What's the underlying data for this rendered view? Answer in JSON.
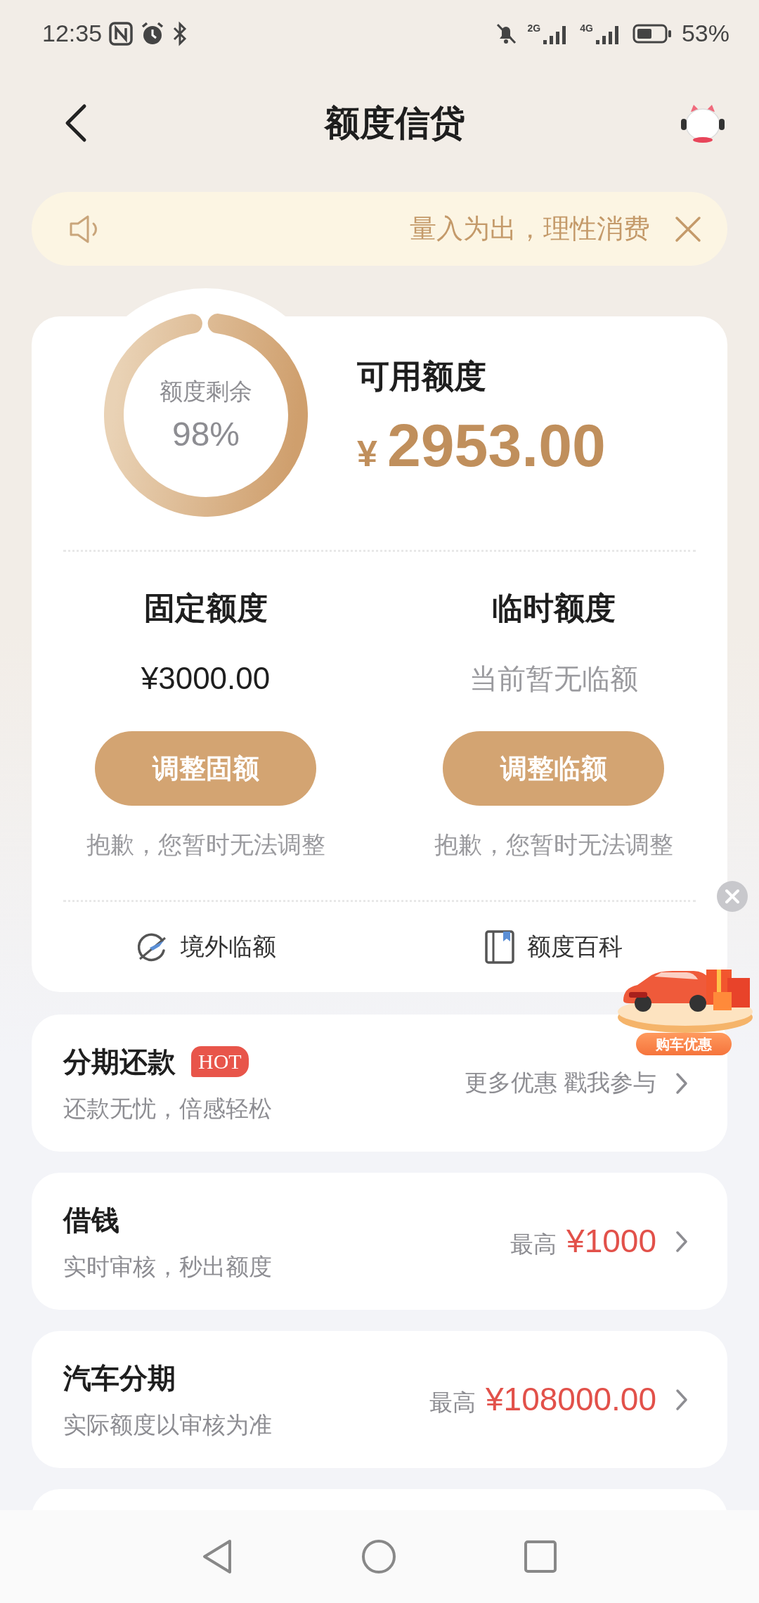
{
  "status_bar": {
    "time": "12:35",
    "network": [
      "2G",
      "4G"
    ],
    "battery": "53%"
  },
  "header": {
    "title": "额度信贷"
  },
  "notice": {
    "text": "量入为出，理性消费"
  },
  "credit": {
    "ring_label": "额度剩余",
    "ring_value": "98%",
    "level": 0.98,
    "available_label": "可用额度",
    "currency": "¥",
    "available_amount": "2953.00",
    "columns": [
      {
        "title": "固定额度",
        "value": "¥3000.00",
        "muted": false,
        "button": "调整固额",
        "note": "抱歉，您暂时无法调整"
      },
      {
        "title": "临时额度",
        "value": "当前暂无临额",
        "muted": true,
        "button": "调整临额",
        "note": "抱歉，您暂时无法调整"
      }
    ],
    "links": [
      {
        "kind": "plane",
        "label": "境外临额"
      },
      {
        "kind": "book",
        "label": "额度百科"
      }
    ]
  },
  "promo": {
    "label": "购车优惠"
  },
  "products": [
    {
      "kind": "offer",
      "title": "分期还款",
      "badge": "HOT",
      "subtitle": "还款无忧，倍感轻松",
      "right_text": "更多优惠 戳我参与"
    },
    {
      "kind": "limit",
      "title": "借钱",
      "subtitle": "实时审核，秒出额度",
      "prefix": "最高",
      "amount": "¥1000"
    },
    {
      "kind": "limit",
      "title": "汽车分期",
      "subtitle": "实际额度以审核为准",
      "prefix": "最高",
      "amount": "¥108000.00"
    }
  ]
}
